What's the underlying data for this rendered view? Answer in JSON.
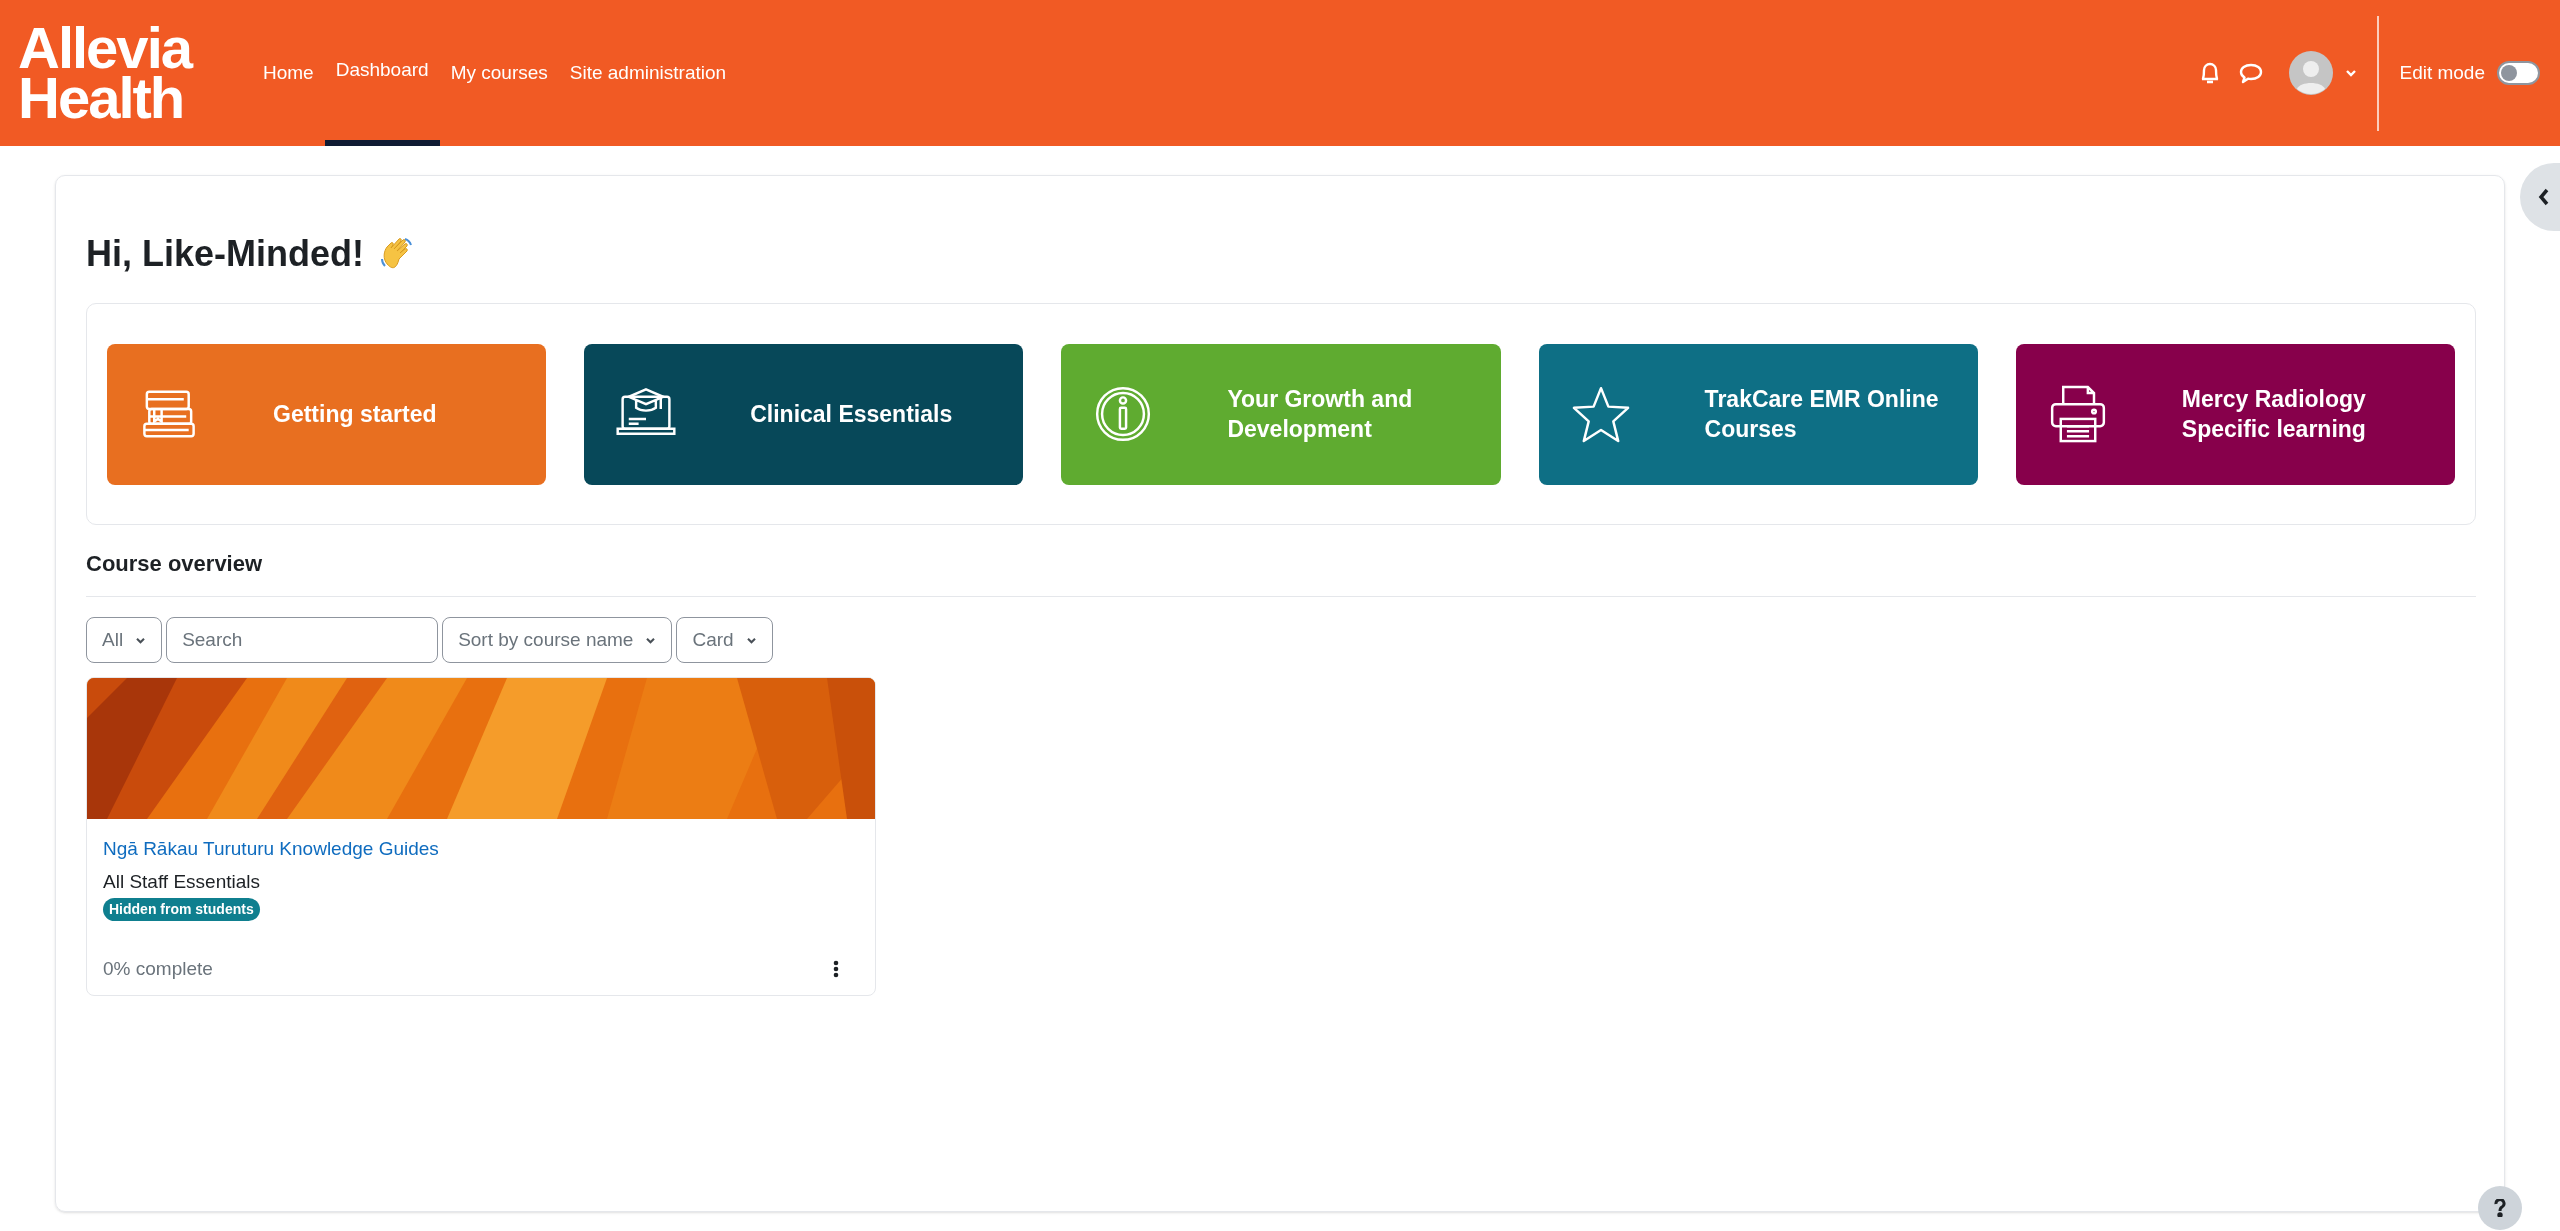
{
  "header": {
    "logo": [
      "Allevia",
      "Health"
    ],
    "nav": [
      {
        "label": "Home",
        "selected": false
      },
      {
        "label": "Dashboard",
        "selected": true
      },
      {
        "label": "My courses",
        "selected": false
      },
      {
        "label": "Site administration",
        "selected": false
      }
    ],
    "edit_mode": {
      "label": "Edit mode",
      "on": false
    }
  },
  "greeting": "Hi, Like-Minded!",
  "tiles": [
    {
      "label": "Getting started",
      "color": "#e86f20"
    },
    {
      "label": "Clinical Essentials",
      "color": "#074859"
    },
    {
      "label": "Your Growth and Development",
      "color": "#5fab30"
    },
    {
      "label": "TrakCare EMR Online Courses",
      "color": "#0e6f85"
    },
    {
      "label": "Mercy Radiology Specific learning",
      "color": "#87004b"
    }
  ],
  "course_overview": {
    "title": "Course overview",
    "filters": [
      {
        "kind": "dropdown",
        "label": "All"
      },
      {
        "kind": "search",
        "placeholder": "Search"
      },
      {
        "kind": "dropdown",
        "label": "Sort by course name"
      },
      {
        "kind": "dropdown",
        "label": "Card"
      }
    ],
    "courses": [
      {
        "name": "Ngā Rākau Turuturu Knowledge Guides",
        "category": "All Staff Essentials",
        "badge": "Hidden from students",
        "progress": "0% complete"
      }
    ]
  }
}
